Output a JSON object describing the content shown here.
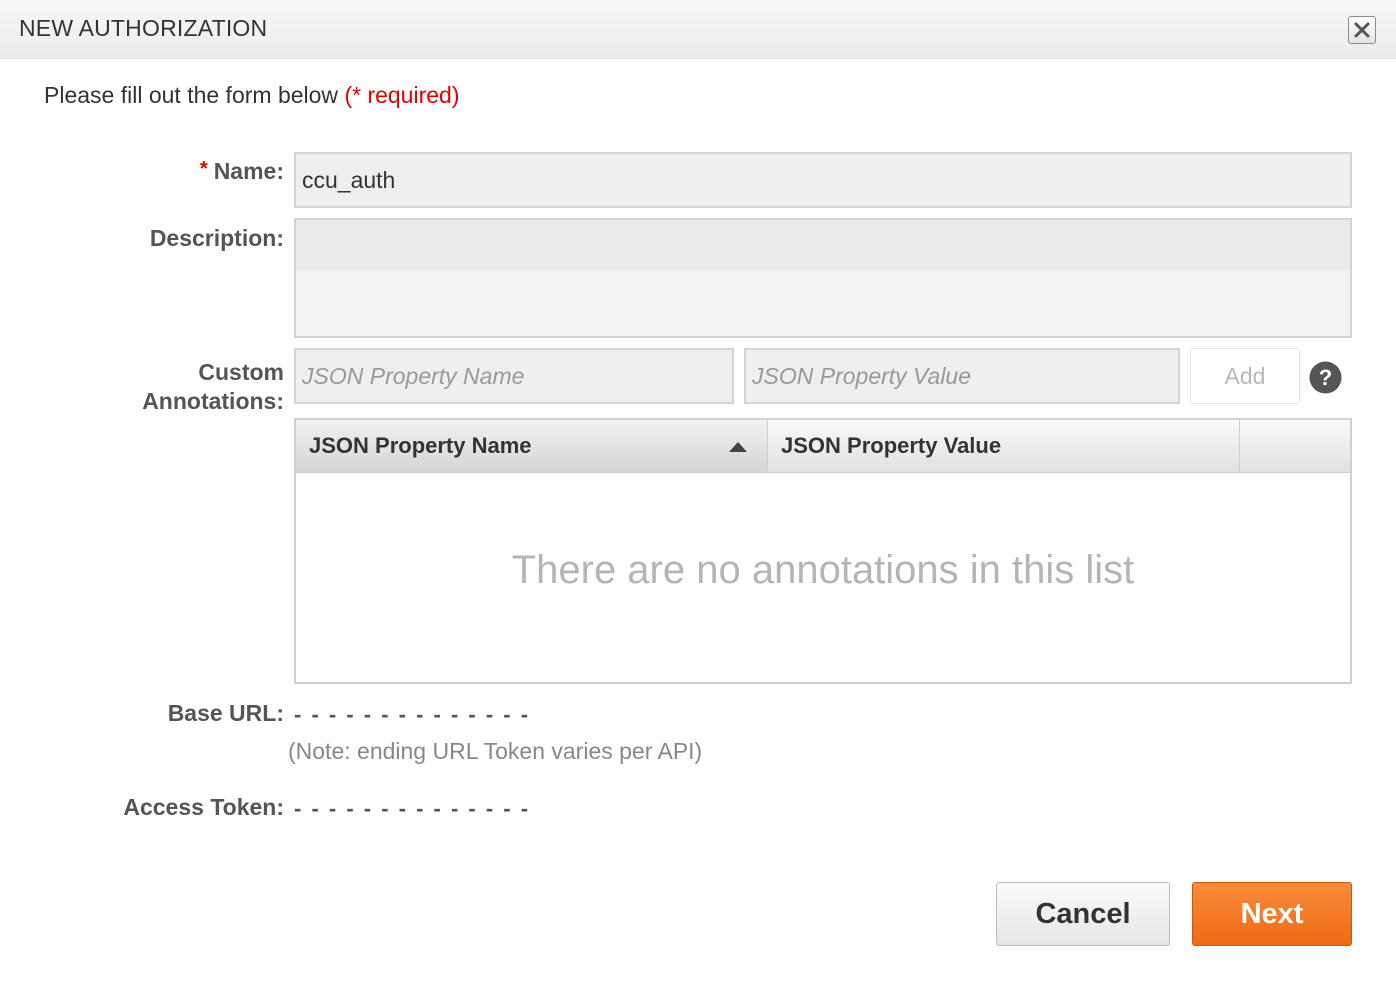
{
  "dialog": {
    "title": "NEW AUTHORIZATION"
  },
  "form": {
    "intro": "Please fill out the form below",
    "required_note": "(* required)",
    "required_star": "*",
    "name": {
      "label": "Name:",
      "value": "ccu_auth"
    },
    "description": {
      "label": "Description:",
      "value": ""
    },
    "annotations": {
      "label_line1": "Custom",
      "label_line2": "Annotations:",
      "name_placeholder": "JSON Property Name",
      "value_placeholder": "JSON Property Value",
      "add_label": "Add",
      "help_icon": "question-circle-icon"
    },
    "grid": {
      "columns": [
        "JSON Property Name",
        "JSON Property Value",
        ""
      ],
      "sort_icon": "sort-ascending-icon",
      "empty_message": "There are no annotations in this list"
    },
    "base_url": {
      "label": "Base URL:",
      "value": "- - - - - - - - - - - - - -",
      "note": "(Note: ending URL Token varies per API)"
    },
    "access_token": {
      "label": "Access Token:",
      "value": "- - - - - - - - - - - - - -"
    }
  },
  "buttons": {
    "cancel": "Cancel",
    "next": "Next"
  },
  "colors": {
    "required_red": "#e60000",
    "next_orange": "#f07a22"
  }
}
